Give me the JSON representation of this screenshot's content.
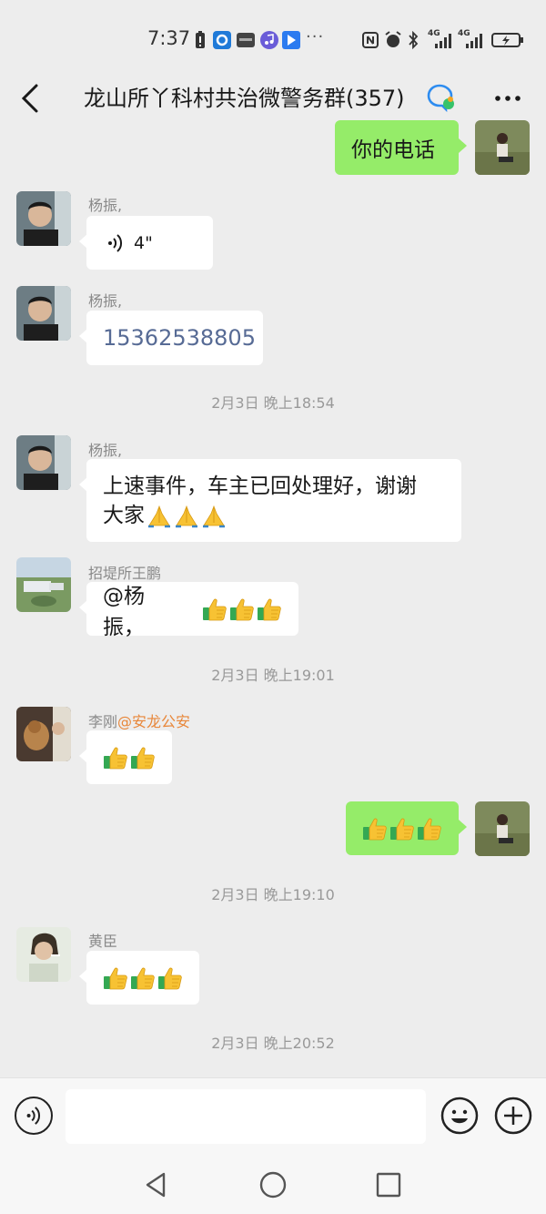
{
  "status_bar": {
    "time": "7:37",
    "network_1": "4G",
    "network_2": "4G"
  },
  "header": {
    "title": "龙山所丫科村共治微警务群(357)"
  },
  "messages": [
    {
      "sender": "",
      "is_me": true,
      "text": "你的电话"
    },
    {
      "sender": "杨振,",
      "type": "voice",
      "duration": "4\""
    },
    {
      "sender": "杨振,",
      "text": "15362538805"
    },
    {
      "timestamp": "2月3日 晚上18:54"
    },
    {
      "sender": "杨振,",
      "text_line1": "上速事件，车主已回处理好，谢谢",
      "text_line2": "大家",
      "emoji": [
        "pray",
        "pray",
        "pray"
      ]
    },
    {
      "sender": "招堤所王鹏",
      "text": "@杨振，",
      "emoji": [
        "thumbs-up",
        "thumbs-up",
        "thumbs-up"
      ]
    },
    {
      "timestamp": "2月3日 晚上19:01"
    },
    {
      "sender": "李刚",
      "sender_mention": "@安龙公安",
      "emoji": [
        "thumbs-up",
        "thumbs-up"
      ]
    },
    {
      "is_me": true,
      "emoji": [
        "thumbs-up",
        "thumbs-up",
        "thumbs-up"
      ]
    },
    {
      "timestamp": "2月3日 晚上19:10"
    },
    {
      "sender": "黄臣",
      "emoji": [
        "thumbs-up",
        "thumbs-up",
        "thumbs-up"
      ]
    },
    {
      "timestamp": "2月3日 晚上20:52"
    }
  ],
  "input": {
    "value": "",
    "placeholder": ""
  },
  "colors": {
    "background": "#ededed",
    "my_bubble": "#95ec69",
    "other_bubble": "#ffffff",
    "link": "#576b95",
    "mention": "#e8873a"
  }
}
